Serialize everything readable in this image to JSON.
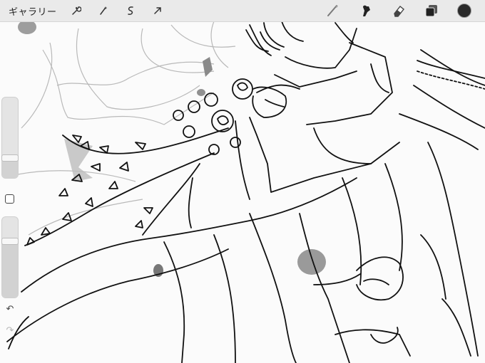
{
  "toolbar": {
    "gallery_label": "ギャラリー",
    "left_tools": [
      {
        "name": "actions",
        "icon": "wrench-icon"
      },
      {
        "name": "adjustments",
        "icon": "magic-wand-icon"
      },
      {
        "name": "selection",
        "icon": "selection-s-icon"
      },
      {
        "name": "transform",
        "icon": "arrow-cursor-icon"
      }
    ],
    "right_tools": [
      {
        "name": "brush",
        "icon": "brush-icon"
      },
      {
        "name": "smudge",
        "icon": "smudge-finger-icon"
      },
      {
        "name": "eraser",
        "icon": "eraser-icon"
      },
      {
        "name": "layers",
        "icon": "layers-icon"
      }
    ],
    "current_color": "#2a2a2a"
  },
  "sidebar": {
    "brush_size_level": 0.25,
    "opacity_level": 0.7,
    "modify_icon": "square-icon",
    "undo_icon": "undo-arrow-icon",
    "redo_icon": "redo-arrow-icon"
  },
  "colors": {
    "toolbar_bg": "#eaeaea",
    "ink": "#111111",
    "sketch_gray": "#b8b8b8",
    "smudge_gray": "#8c8c8c"
  }
}
